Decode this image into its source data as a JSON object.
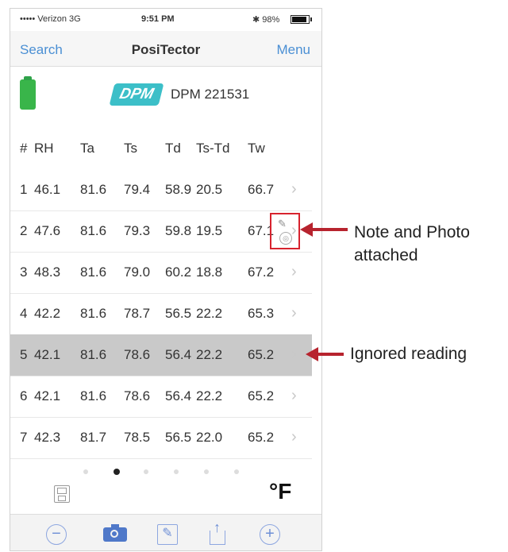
{
  "status": {
    "carrier": "••••• Verizon  3G",
    "time": "9:51 PM",
    "battery_text": "✱ 98%"
  },
  "nav": {
    "back": "Search",
    "title": "PosiTector",
    "menu": "Menu"
  },
  "probe": {
    "logo": "DPM",
    "id": "DPM 221531"
  },
  "table": {
    "headers": [
      "#",
      "RH",
      "Ta",
      "Ts",
      "Td",
      "Ts-Td",
      "Tw"
    ],
    "rows": [
      [
        "1",
        "46.1",
        "81.6",
        "79.4",
        "58.9",
        "20.5",
        "66.7"
      ],
      [
        "2",
        "47.6",
        "81.6",
        "79.3",
        "59.8",
        "19.5",
        "67.1"
      ],
      [
        "3",
        "48.3",
        "81.6",
        "79.0",
        "60.2",
        "18.8",
        "67.2"
      ],
      [
        "4",
        "42.2",
        "81.6",
        "78.7",
        "56.5",
        "22.2",
        "65.3"
      ],
      [
        "5",
        "42.1",
        "81.6",
        "78.6",
        "56.4",
        "22.2",
        "65.2"
      ],
      [
        "6",
        "42.1",
        "81.6",
        "78.6",
        "56.4",
        "22.2",
        "65.2"
      ],
      [
        "7",
        "42.3",
        "81.7",
        "78.5",
        "56.5",
        "22.0",
        "65.2"
      ]
    ],
    "ignored_row": 5,
    "attachment_row": 2
  },
  "pager": {
    "pages": 6,
    "current": 1
  },
  "unit": "°F",
  "toolbar": [
    "minus-icon",
    "camera-icon",
    "edit-icon",
    "share-icon",
    "plus-icon"
  ],
  "annotations": {
    "note": "Note and Photo\nattached",
    "ignored": "Ignored reading"
  },
  "colors": {
    "accent": "#4a8fd4",
    "annotation_red": "#b7232e",
    "dpm_logo": "#3cbfc8",
    "battery_green": "#39b54a"
  }
}
